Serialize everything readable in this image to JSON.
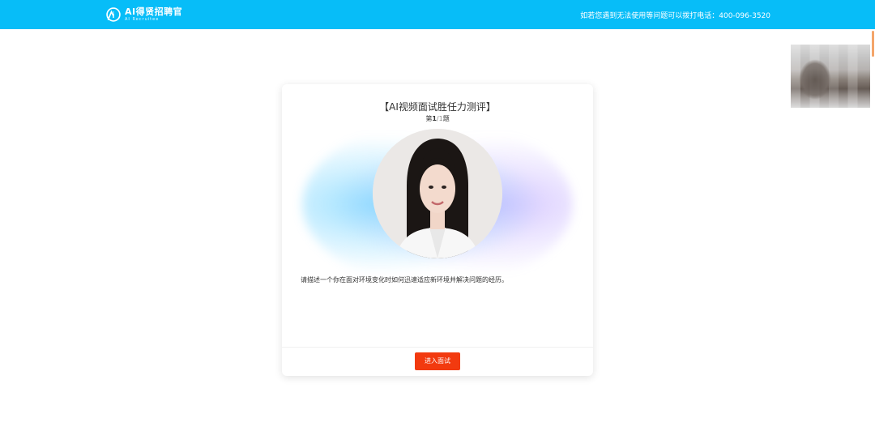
{
  "header": {
    "logo_title": "AI得贤招聘官",
    "logo_subtitle": "AI Recruitee",
    "contact_text": "如若您遇到无法使用等问题可以拨打电话：400-096-3520",
    "background_color": "#07bdf8"
  },
  "camera_preview": {
    "label": "camera-preview"
  },
  "interview": {
    "title": "【AI视频面试胜任力测评】",
    "progress_prefix": "第",
    "progress_current": "1",
    "progress_sep": "/",
    "progress_total": "1",
    "progress_suffix": "题",
    "question": "请描述一个你在面对环境变化时如何迅速适应新环境并解决问题的经历。",
    "start_button_label": "进入面试",
    "accent_color": "#f23a0f"
  }
}
